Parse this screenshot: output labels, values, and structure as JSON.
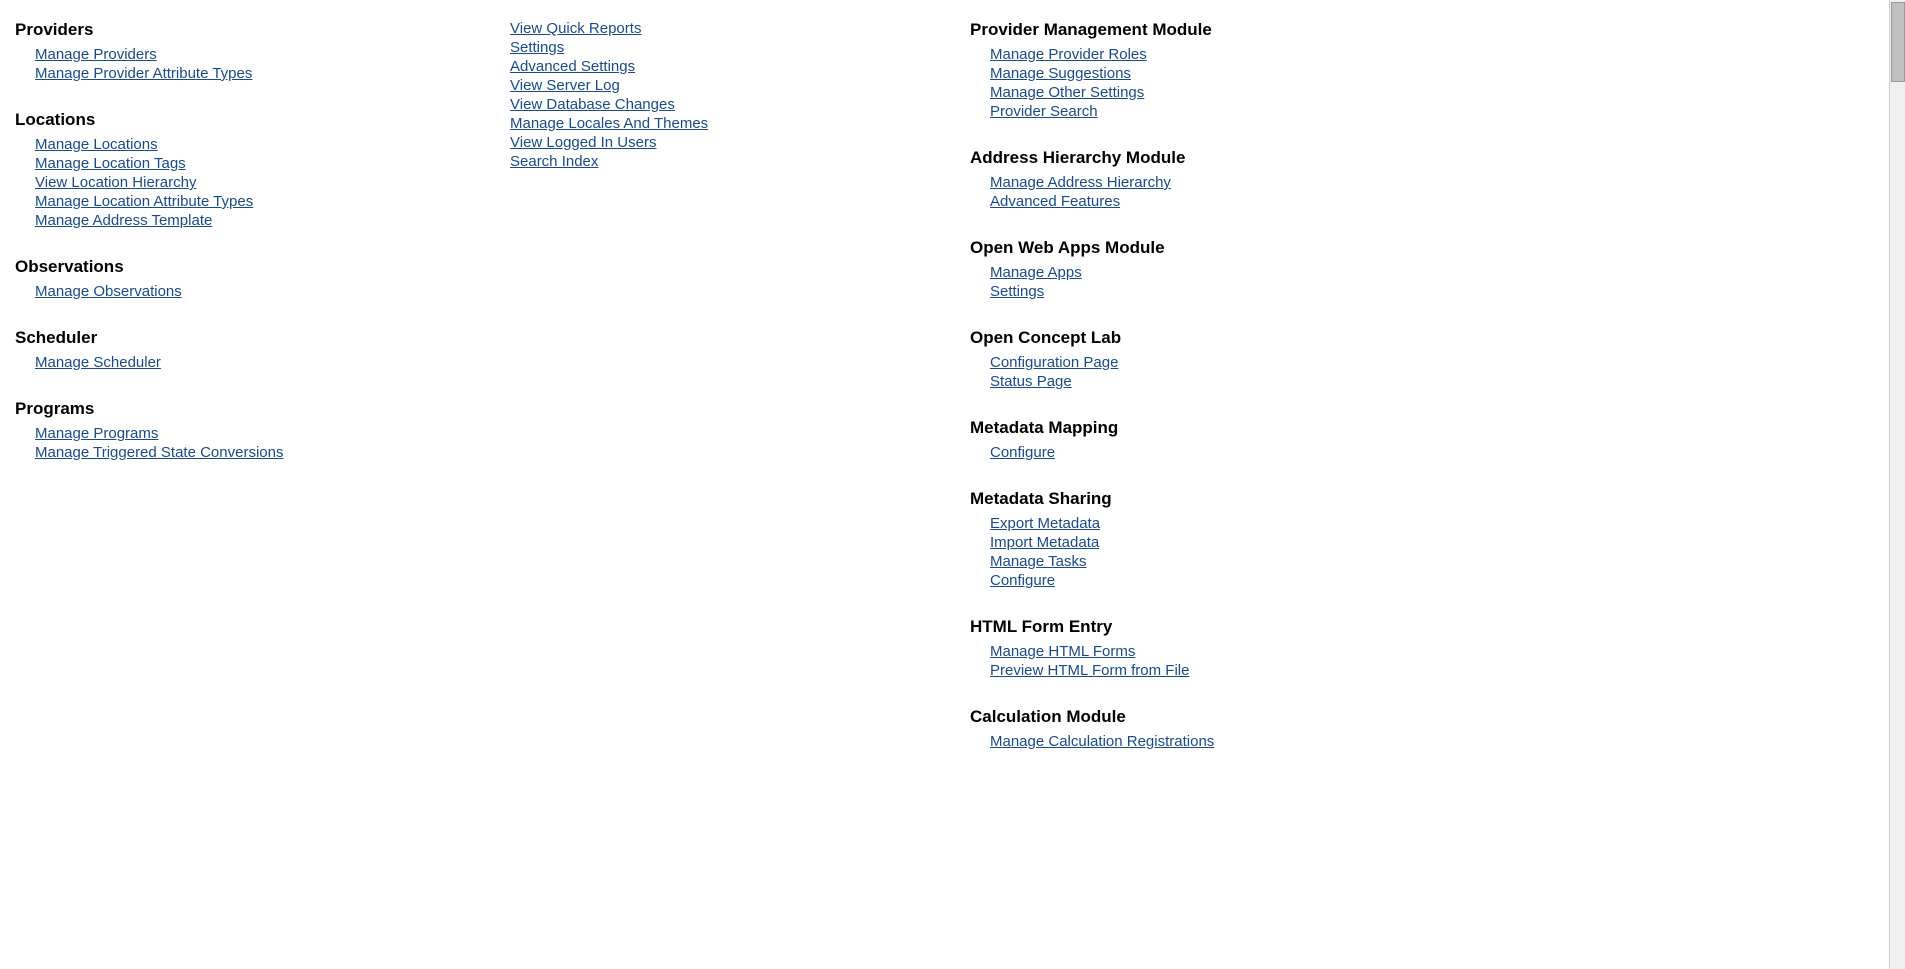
{
  "columns": {
    "left": {
      "sections": [
        {
          "id": "providers",
          "heading": "Providers",
          "links": [
            {
              "id": "manage-providers",
              "label": "Manage Providers"
            },
            {
              "id": "manage-provider-attribute-types",
              "label": "Manage Provider Attribute Types"
            }
          ]
        },
        {
          "id": "locations",
          "heading": "Locations",
          "links": [
            {
              "id": "manage-locations",
              "label": "Manage Locations"
            },
            {
              "id": "manage-location-tags",
              "label": "Manage Location Tags"
            },
            {
              "id": "view-location-hierarchy",
              "label": "View Location Hierarchy"
            },
            {
              "id": "manage-location-attribute-types",
              "label": "Manage Location Attribute Types"
            },
            {
              "id": "manage-address-template",
              "label": "Manage Address Template"
            }
          ]
        },
        {
          "id": "observations",
          "heading": "Observations",
          "links": [
            {
              "id": "manage-observations",
              "label": "Manage Observations"
            }
          ]
        },
        {
          "id": "scheduler",
          "heading": "Scheduler",
          "links": [
            {
              "id": "manage-scheduler",
              "label": "Manage Scheduler"
            }
          ]
        },
        {
          "id": "programs",
          "heading": "Programs",
          "links": [
            {
              "id": "manage-programs",
              "label": "Manage Programs"
            },
            {
              "id": "manage-triggered-state-conversions",
              "label": "Manage Triggered State Conversions"
            }
          ]
        }
      ]
    },
    "middle": {
      "sections": [
        {
          "id": "settings-group",
          "heading": "",
          "links": [
            {
              "id": "view-quick-reports",
              "label": "View Quick Reports"
            },
            {
              "id": "settings",
              "label": "Settings"
            },
            {
              "id": "advanced-settings",
              "label": "Advanced Settings"
            },
            {
              "id": "view-server-log",
              "label": "View Server Log"
            },
            {
              "id": "view-database-changes",
              "label": "View Database Changes"
            },
            {
              "id": "manage-locales-and-themes",
              "label": "Manage Locales And Themes"
            },
            {
              "id": "view-logged-in-users",
              "label": "View Logged In Users"
            },
            {
              "id": "search-index",
              "label": "Search Index"
            }
          ]
        }
      ]
    },
    "right": {
      "sections": [
        {
          "id": "provider-management-module",
          "heading": "Provider Management Module",
          "links": [
            {
              "id": "manage-provider-roles",
              "label": "Manage Provider Roles"
            },
            {
              "id": "manage-suggestions",
              "label": "Manage Suggestions"
            },
            {
              "id": "manage-other-settings",
              "label": "Manage Other Settings"
            },
            {
              "id": "provider-search",
              "label": "Provider Search"
            }
          ]
        },
        {
          "id": "address-hierarchy-module",
          "heading": "Address Hierarchy Module",
          "links": [
            {
              "id": "manage-address-hierarchy",
              "label": "Manage Address Hierarchy"
            },
            {
              "id": "advanced-features",
              "label": "Advanced Features"
            }
          ]
        },
        {
          "id": "open-web-apps-module",
          "heading": "Open Web Apps Module",
          "links": [
            {
              "id": "manage-apps",
              "label": "Manage Apps"
            },
            {
              "id": "settings-apps",
              "label": "Settings"
            }
          ]
        },
        {
          "id": "open-concept-lab",
          "heading": "Open Concept Lab",
          "links": [
            {
              "id": "configuration-page",
              "label": "Configuration Page"
            },
            {
              "id": "status-page",
              "label": "Status Page"
            }
          ]
        },
        {
          "id": "metadata-mapping",
          "heading": "Metadata Mapping",
          "links": [
            {
              "id": "configure-mapping",
              "label": "Configure"
            }
          ]
        },
        {
          "id": "metadata-sharing",
          "heading": "Metadata Sharing",
          "links": [
            {
              "id": "export-metadata",
              "label": "Export Metadata"
            },
            {
              "id": "import-metadata",
              "label": "Import Metadata"
            },
            {
              "id": "manage-tasks",
              "label": "Manage Tasks"
            },
            {
              "id": "configure-sharing",
              "label": "Configure"
            }
          ]
        },
        {
          "id": "html-form-entry",
          "heading": "HTML Form Entry",
          "links": [
            {
              "id": "manage-html-forms",
              "label": "Manage HTML Forms"
            },
            {
              "id": "preview-html-form-from-file",
              "label": "Preview HTML Form from File"
            }
          ]
        },
        {
          "id": "calculation-module",
          "heading": "Calculation Module",
          "links": [
            {
              "id": "manage-calculation-registrations",
              "label": "Manage Calculation Registrations"
            }
          ]
        }
      ]
    }
  }
}
